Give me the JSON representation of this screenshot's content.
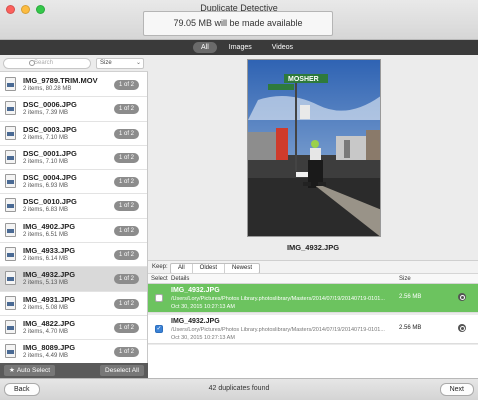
{
  "window": {
    "title": "Duplicate Detective"
  },
  "header": {
    "space_message": "79.05 MB will be made available"
  },
  "tabs": [
    {
      "label": "All",
      "active": true
    },
    {
      "label": "Images",
      "active": false
    },
    {
      "label": "Videos",
      "active": false
    }
  ],
  "sidebar": {
    "search_placeholder": "Search",
    "sort_value": "Size",
    "files": [
      {
        "name": "IMG_9789.TRIM.MOV",
        "info": "2 items, 80.28 MB",
        "badge": "1 of 2",
        "kind": "video"
      },
      {
        "name": "DSC_0006.JPG",
        "info": "2 items, 7.39 MB",
        "badge": "1 of 2"
      },
      {
        "name": "DSC_0003.JPG",
        "info": "2 items, 7.10 MB",
        "badge": "1 of 2"
      },
      {
        "name": "DSC_0001.JPG",
        "info": "2 items, 7.10 MB",
        "badge": "1 of 2"
      },
      {
        "name": "DSC_0004.JPG",
        "info": "2 items, 6.93 MB",
        "badge": "1 of 2"
      },
      {
        "name": "DSC_0010.JPG",
        "info": "2 items, 6.83 MB",
        "badge": "1 of 2"
      },
      {
        "name": "IMG_4902.JPG",
        "info": "2 items, 6.51 MB",
        "badge": "1 of 2"
      },
      {
        "name": "IMG_4933.JPG",
        "info": "2 items, 6.14 MB",
        "badge": "1 of 2"
      },
      {
        "name": "IMG_4932.JPG",
        "info": "2 items, 5.13 MB",
        "badge": "1 of 2",
        "selected": true
      },
      {
        "name": "IMG_4931.JPG",
        "info": "2 items, 5.08 MB",
        "badge": "1 of 2"
      },
      {
        "name": "IMG_4822.JPG",
        "info": "2 items, 4.70 MB",
        "badge": "1 of 2"
      },
      {
        "name": "IMG_8089.JPG",
        "info": "2 items, 4.49 MB",
        "badge": "1 of 2"
      }
    ],
    "auto_select_label": "Auto Select",
    "deselect_all_label": "Deselect All"
  },
  "preview": {
    "filename": "IMG_4932.JPG",
    "sign_text": "MOSHER"
  },
  "keep": {
    "label": "Keep:",
    "options": [
      "All",
      "Oldest",
      "Newest"
    ]
  },
  "table": {
    "columns": {
      "select": "Select",
      "details": "Details",
      "size": "Size"
    },
    "rows": [
      {
        "name": "IMG_4932.JPG",
        "path": "/Users/Lory/Pictures/Photos Library.photoslibrary/Masters/2014/07/19/20140719-0101...",
        "date": "Oct 30, 2015 10:27:13 AM",
        "size": "2.56 MB",
        "checked": false,
        "highlighted": true
      },
      {
        "name": "IMG_4932.JPG",
        "path": "/Users/Lory/Pictures/Photos Library.photoslibrary/Masters/2014/07/19/20140719-0101...",
        "date": "Oct 30, 2015 10:27:13 AM",
        "size": "2.56 MB",
        "checked": true,
        "highlighted": false
      }
    ]
  },
  "footer": {
    "back_label": "Back",
    "status": "42 duplicates found",
    "next_label": "Next"
  },
  "colors": {
    "highlight_row": "#6cc35f",
    "checkbox_on": "#3b82d6",
    "tab_bar": "#3a3a3a"
  }
}
